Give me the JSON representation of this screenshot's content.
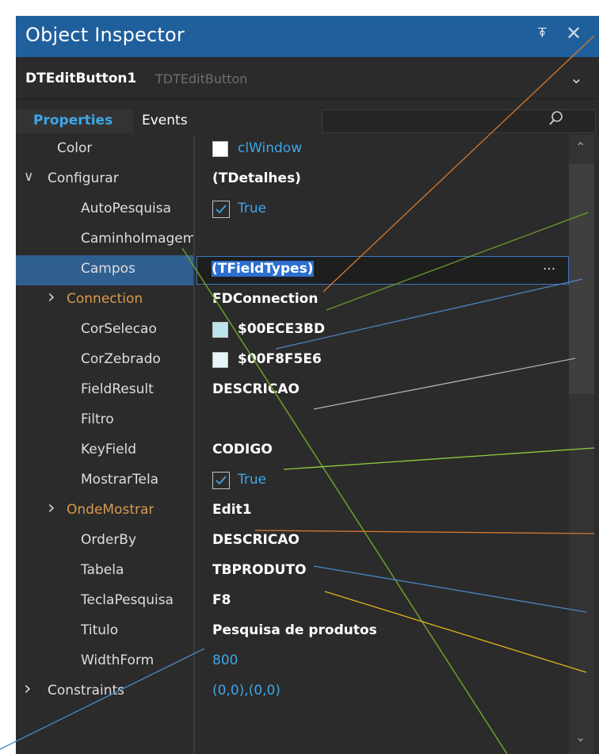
{
  "window": {
    "title": "Object Inspector",
    "pin_glyph": "⍕",
    "close_glyph": "✕"
  },
  "object_selector": {
    "name": "DTEditButton1",
    "type": "TDTEditButton",
    "chevron": "⌄"
  },
  "tabs": [
    {
      "label": "Properties",
      "active": true
    },
    {
      "label": "Events",
      "active": false
    }
  ],
  "search": {
    "icon": "search-icon",
    "value": ""
  },
  "properties": [
    {
      "name": "Color",
      "value": "clWindow",
      "kind": "color",
      "swatch": "#ffffff",
      "indent": 1
    },
    {
      "name": "Configurar",
      "value": "(TDetalhes)",
      "kind": "bold",
      "indent": 0,
      "expander": "∨"
    },
    {
      "name": "AutoPesquisa",
      "value": "True",
      "kind": "check",
      "indent": 2
    },
    {
      "name": "CaminhoImagem",
      "value": "",
      "kind": "text",
      "indent": 2
    },
    {
      "name": "Campos",
      "value": "(TFieldTypes)",
      "kind": "edit",
      "indent": 2,
      "selected": true,
      "ellipsis": "..."
    },
    {
      "name": "Connection",
      "value": "FDConnection",
      "kind": "bold",
      "indent": 1,
      "expander": "›",
      "orange": true
    },
    {
      "name": "CorSelecao",
      "value": "$00ECE3BD",
      "kind": "colorbold",
      "swatch": "#bde3ec",
      "indent": 2
    },
    {
      "name": "CorZebrado",
      "value": "$00F8F5E6",
      "kind": "colorbold",
      "swatch": "#e6f5f8",
      "indent": 2
    },
    {
      "name": "FieldResult",
      "value": "DESCRICAO",
      "kind": "bold",
      "indent": 2
    },
    {
      "name": "Filtro",
      "value": "",
      "kind": "text",
      "indent": 2
    },
    {
      "name": "KeyField",
      "value": "CODIGO",
      "kind": "bold",
      "indent": 2
    },
    {
      "name": "MostrarTela",
      "value": "True",
      "kind": "check",
      "indent": 2
    },
    {
      "name": "OndeMostrar",
      "value": "Edit1",
      "kind": "bold",
      "indent": 1,
      "expander": "›",
      "orange": true
    },
    {
      "name": "OrderBy",
      "value": "DESCRICAO",
      "kind": "bold",
      "indent": 2
    },
    {
      "name": "Tabela",
      "value": "TBPRODUTO",
      "kind": "bold",
      "indent": 2
    },
    {
      "name": "TeclaPesquisa",
      "value": "F8",
      "kind": "bold",
      "indent": 2
    },
    {
      "name": "Titulo",
      "value": "Pesquisa de produtos",
      "kind": "bold",
      "indent": 2
    },
    {
      "name": "WidthForm",
      "value": "800",
      "kind": "blue",
      "indent": 2
    },
    {
      "name": "Constraints",
      "value": "(0,0),(0,0)",
      "kind": "blue",
      "indent": 0,
      "expander": "›"
    }
  ],
  "scrollbar": {
    "up": "⌃",
    "down": "⌄"
  },
  "callout_colors": {
    "orange": "#d8782a",
    "green": "#6a9a2c",
    "blue": "#4d86c4",
    "gray": "#b0b0b0",
    "lightgreen": "#8ccf3c",
    "yellow": "#e3b21a"
  }
}
